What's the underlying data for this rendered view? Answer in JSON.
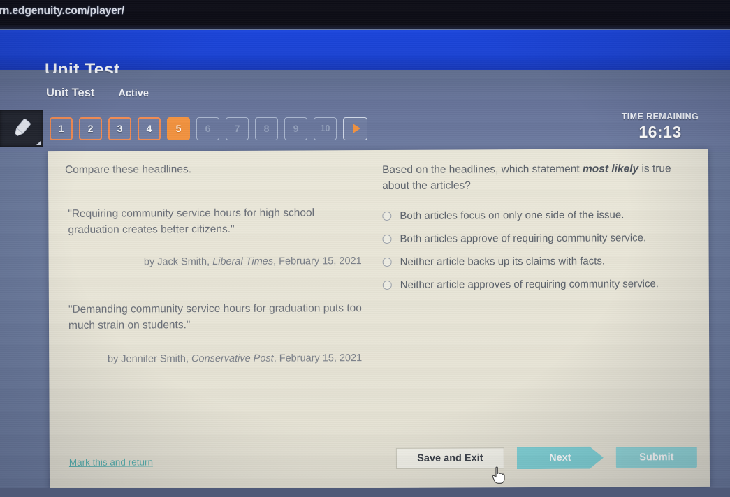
{
  "browser": {
    "url": "rn.edgenuity.com/player/"
  },
  "header": {
    "clipped_title": "Unit Test",
    "assignment_name": "Unit Test",
    "status": "Active"
  },
  "nav": {
    "pen_icon": "highlighter-icon",
    "questions": [
      {
        "label": "1",
        "state": "done"
      },
      {
        "label": "2",
        "state": "done"
      },
      {
        "label": "3",
        "state": "done"
      },
      {
        "label": "4",
        "state": "done"
      },
      {
        "label": "5",
        "state": "current"
      },
      {
        "label": "6",
        "state": "pending"
      },
      {
        "label": "7",
        "state": "pending"
      },
      {
        "label": "8",
        "state": "pending"
      },
      {
        "label": "9",
        "state": "pending"
      },
      {
        "label": "10",
        "state": "pending"
      }
    ],
    "next_arrow_icon": "play-arrow-icon"
  },
  "timer": {
    "label": "TIME REMAINING",
    "value": "16:13"
  },
  "passage": {
    "intro": "Compare these headlines.",
    "headline1": "\"Requiring community service hours for high school graduation creates better citizens.\"",
    "byline1_prefix": "by Jack Smith, ",
    "byline1_publication": "Liberal Times",
    "byline1_suffix": ", February 15, 2021",
    "headline2": "\"Demanding community service hours for graduation puts too much strain on students.\"",
    "byline2_prefix": "by Jennifer Smith, ",
    "byline2_publication": "Conservative Post",
    "byline2_suffix": ", February 15, 2021"
  },
  "question": {
    "text_before": "Based on the headlines, which statement ",
    "emphasis": "most likely",
    "text_after": " is true about the articles?",
    "options": [
      {
        "label": "Both articles focus on only one side of the issue.",
        "selected": false
      },
      {
        "label": "Both articles approve of requiring community service.",
        "selected": false
      },
      {
        "label": "Neither article backs up its claims with facts.",
        "selected": false
      },
      {
        "label": "Neither article approves of requiring community service.",
        "selected": false
      }
    ]
  },
  "footer": {
    "mark_link": "Mark this and return",
    "save_and_exit": "Save and Exit",
    "next": "Next",
    "submit": "Submit"
  },
  "colors": {
    "page_background": "#6b7a9c",
    "top_bar_blue": "#1a44d8",
    "panel_cream": "#e9e6d8",
    "accent_orange": "#f2923f",
    "accent_teal": "#7fd0d4",
    "link_teal": "#3fa8a8"
  }
}
